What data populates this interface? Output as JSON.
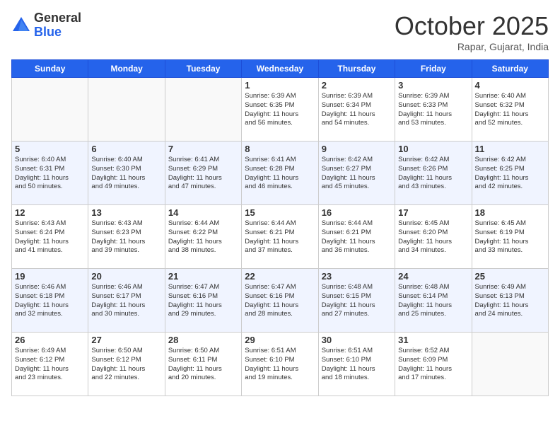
{
  "header": {
    "logo_general": "General",
    "logo_blue": "Blue",
    "month": "October 2025",
    "location": "Rapar, Gujarat, India"
  },
  "days": [
    "Sunday",
    "Monday",
    "Tuesday",
    "Wednesday",
    "Thursday",
    "Friday",
    "Saturday"
  ],
  "weeks": [
    [
      {
        "date": "",
        "info": ""
      },
      {
        "date": "",
        "info": ""
      },
      {
        "date": "",
        "info": ""
      },
      {
        "date": "1",
        "info": "Sunrise: 6:39 AM\nSunset: 6:35 PM\nDaylight: 11 hours\nand 56 minutes."
      },
      {
        "date": "2",
        "info": "Sunrise: 6:39 AM\nSunset: 6:34 PM\nDaylight: 11 hours\nand 54 minutes."
      },
      {
        "date": "3",
        "info": "Sunrise: 6:39 AM\nSunset: 6:33 PM\nDaylight: 11 hours\nand 53 minutes."
      },
      {
        "date": "4",
        "info": "Sunrise: 6:40 AM\nSunset: 6:32 PM\nDaylight: 11 hours\nand 52 minutes."
      }
    ],
    [
      {
        "date": "5",
        "info": "Sunrise: 6:40 AM\nSunset: 6:31 PM\nDaylight: 11 hours\nand 50 minutes."
      },
      {
        "date": "6",
        "info": "Sunrise: 6:40 AM\nSunset: 6:30 PM\nDaylight: 11 hours\nand 49 minutes."
      },
      {
        "date": "7",
        "info": "Sunrise: 6:41 AM\nSunset: 6:29 PM\nDaylight: 11 hours\nand 47 minutes."
      },
      {
        "date": "8",
        "info": "Sunrise: 6:41 AM\nSunset: 6:28 PM\nDaylight: 11 hours\nand 46 minutes."
      },
      {
        "date": "9",
        "info": "Sunrise: 6:42 AM\nSunset: 6:27 PM\nDaylight: 11 hours\nand 45 minutes."
      },
      {
        "date": "10",
        "info": "Sunrise: 6:42 AM\nSunset: 6:26 PM\nDaylight: 11 hours\nand 43 minutes."
      },
      {
        "date": "11",
        "info": "Sunrise: 6:42 AM\nSunset: 6:25 PM\nDaylight: 11 hours\nand 42 minutes."
      }
    ],
    [
      {
        "date": "12",
        "info": "Sunrise: 6:43 AM\nSunset: 6:24 PM\nDaylight: 11 hours\nand 41 minutes."
      },
      {
        "date": "13",
        "info": "Sunrise: 6:43 AM\nSunset: 6:23 PM\nDaylight: 11 hours\nand 39 minutes."
      },
      {
        "date": "14",
        "info": "Sunrise: 6:44 AM\nSunset: 6:22 PM\nDaylight: 11 hours\nand 38 minutes."
      },
      {
        "date": "15",
        "info": "Sunrise: 6:44 AM\nSunset: 6:21 PM\nDaylight: 11 hours\nand 37 minutes."
      },
      {
        "date": "16",
        "info": "Sunrise: 6:44 AM\nSunset: 6:21 PM\nDaylight: 11 hours\nand 36 minutes."
      },
      {
        "date": "17",
        "info": "Sunrise: 6:45 AM\nSunset: 6:20 PM\nDaylight: 11 hours\nand 34 minutes."
      },
      {
        "date": "18",
        "info": "Sunrise: 6:45 AM\nSunset: 6:19 PM\nDaylight: 11 hours\nand 33 minutes."
      }
    ],
    [
      {
        "date": "19",
        "info": "Sunrise: 6:46 AM\nSunset: 6:18 PM\nDaylight: 11 hours\nand 32 minutes."
      },
      {
        "date": "20",
        "info": "Sunrise: 6:46 AM\nSunset: 6:17 PM\nDaylight: 11 hours\nand 30 minutes."
      },
      {
        "date": "21",
        "info": "Sunrise: 6:47 AM\nSunset: 6:16 PM\nDaylight: 11 hours\nand 29 minutes."
      },
      {
        "date": "22",
        "info": "Sunrise: 6:47 AM\nSunset: 6:16 PM\nDaylight: 11 hours\nand 28 minutes."
      },
      {
        "date": "23",
        "info": "Sunrise: 6:48 AM\nSunset: 6:15 PM\nDaylight: 11 hours\nand 27 minutes."
      },
      {
        "date": "24",
        "info": "Sunrise: 6:48 AM\nSunset: 6:14 PM\nDaylight: 11 hours\nand 25 minutes."
      },
      {
        "date": "25",
        "info": "Sunrise: 6:49 AM\nSunset: 6:13 PM\nDaylight: 11 hours\nand 24 minutes."
      }
    ],
    [
      {
        "date": "26",
        "info": "Sunrise: 6:49 AM\nSunset: 6:12 PM\nDaylight: 11 hours\nand 23 minutes."
      },
      {
        "date": "27",
        "info": "Sunrise: 6:50 AM\nSunset: 6:12 PM\nDaylight: 11 hours\nand 22 minutes."
      },
      {
        "date": "28",
        "info": "Sunrise: 6:50 AM\nSunset: 6:11 PM\nDaylight: 11 hours\nand 20 minutes."
      },
      {
        "date": "29",
        "info": "Sunrise: 6:51 AM\nSunset: 6:10 PM\nDaylight: 11 hours\nand 19 minutes."
      },
      {
        "date": "30",
        "info": "Sunrise: 6:51 AM\nSunset: 6:10 PM\nDaylight: 11 hours\nand 18 minutes."
      },
      {
        "date": "31",
        "info": "Sunrise: 6:52 AM\nSunset: 6:09 PM\nDaylight: 11 hours\nand 17 minutes."
      },
      {
        "date": "",
        "info": ""
      }
    ]
  ]
}
